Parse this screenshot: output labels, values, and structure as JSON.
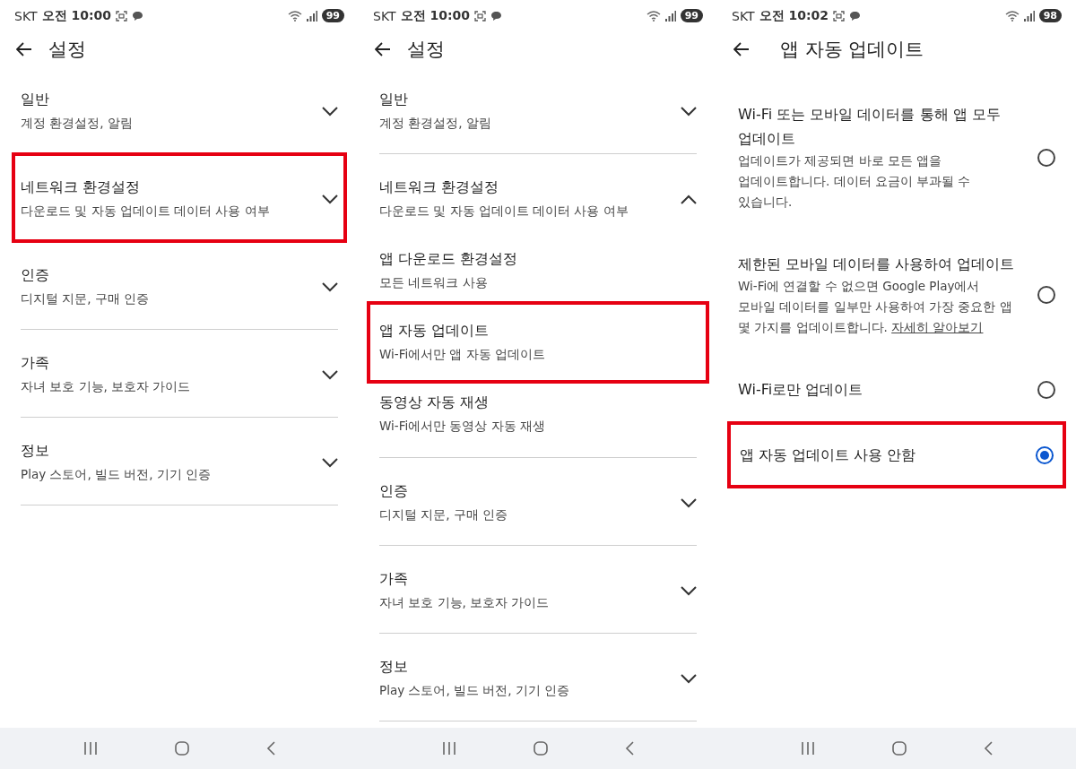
{
  "screens": [
    {
      "kind": "settings",
      "status": {
        "carrier": "SKT",
        "time": "오전 10:00",
        "battery": "99"
      },
      "title": "설정",
      "items": [
        {
          "kind": "section",
          "title": "일반",
          "subtitle": "계정 환경설정, 알림",
          "expanded": false,
          "highlighted": false
        },
        {
          "kind": "section",
          "title": "네트워크 환경설정",
          "subtitle": "다운로드 및 자동 업데이트 데이터 사용 여부",
          "expanded": false,
          "highlighted": true
        },
        {
          "kind": "section",
          "title": "인증",
          "subtitle": "디지털 지문, 구매 인증",
          "expanded": false,
          "highlighted": false
        },
        {
          "kind": "section",
          "title": "가족",
          "subtitle": "자녀 보호 기능, 보호자 가이드",
          "expanded": false,
          "highlighted": false
        },
        {
          "kind": "section",
          "title": "정보",
          "subtitle": "Play 스토어, 빌드 버전, 기기 인증",
          "expanded": false,
          "highlighted": false
        }
      ]
    },
    {
      "kind": "settings",
      "status": {
        "carrier": "SKT",
        "time": "오전 10:00",
        "battery": "99"
      },
      "title": "설정",
      "items": [
        {
          "kind": "section",
          "title": "일반",
          "subtitle": "계정 환경설정, 알림",
          "expanded": false,
          "highlighted": false
        },
        {
          "kind": "section",
          "title": "네트워크 환경설정",
          "subtitle": "다운로드 및 자동 업데이트 데이터 사용 여부",
          "expanded": true,
          "highlighted": false,
          "children": [
            {
              "title": "앱 다운로드 환경설정",
              "subtitle": "모든 네트워크 사용",
              "highlighted": false
            },
            {
              "title": "앱 자동 업데이트",
              "subtitle": "Wi-Fi에서만 앱 자동 업데이트",
              "highlighted": true
            },
            {
              "title": "동영상 자동 재생",
              "subtitle": "Wi-Fi에서만 동영상 자동 재생",
              "highlighted": false
            }
          ]
        },
        {
          "kind": "section",
          "title": "인증",
          "subtitle": "디지털 지문, 구매 인증",
          "expanded": false,
          "highlighted": false
        },
        {
          "kind": "section",
          "title": "가족",
          "subtitle": "자녀 보호 기능, 보호자 가이드",
          "expanded": false,
          "highlighted": false
        },
        {
          "kind": "section",
          "title": "정보",
          "subtitle": "Play 스토어, 빌드 버전, 기기 인증",
          "expanded": false,
          "highlighted": false
        }
      ]
    },
    {
      "kind": "options",
      "status": {
        "carrier": "SKT",
        "time": "오전 10:02",
        "battery": "98"
      },
      "title": "앱 자동 업데이트",
      "options": [
        {
          "title": "Wi-Fi 또는 모바일 데이터를 통해 앱 모두 업데이트",
          "description": "업데이트가 제공되면 바로 모든 앱을 업데이트합니다. 데이터 요금이 부과될 수 있습니다.",
          "selected": false,
          "highlighted": false
        },
        {
          "title": "제한된 모바일 데이터를 사용하여 업데이트",
          "description": "Wi-Fi에 연결할 수 없으면 Google Play에서 모바일 데이터를 일부만 사용하여 가장 중요한 앱 몇 가지를 업데이트합니다.",
          "link": "자세히 알아보기",
          "selected": false,
          "highlighted": false
        },
        {
          "title": "Wi-Fi로만 업데이트",
          "selected": false,
          "highlighted": false
        },
        {
          "title": "앱 자동 업데이트 사용 안함",
          "selected": true,
          "highlighted": true
        }
      ]
    }
  ]
}
